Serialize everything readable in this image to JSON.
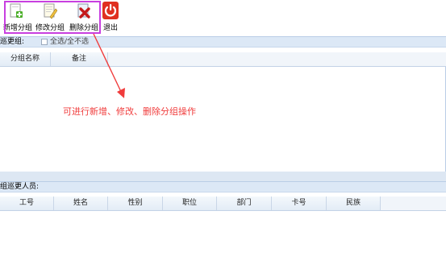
{
  "toolbar": {
    "buttons": [
      {
        "label": "新增分组",
        "icon": "add-group-icon"
      },
      {
        "label": "修改分组",
        "icon": "edit-group-icon"
      },
      {
        "label": "删除分组",
        "icon": "delete-group-icon"
      },
      {
        "label": "退出",
        "icon": "power-icon"
      }
    ]
  },
  "group_section": {
    "title": "巡更组:",
    "select_all_label": "全选/全不选",
    "columns": [
      "分组名称",
      "备注"
    ]
  },
  "annotation": "可进行新增、修改、删除分组操作",
  "member_section": {
    "title": "组巡更人员:",
    "columns": [
      "工号",
      "姓名",
      "性别",
      "职位",
      "部门",
      "卡号",
      "民族"
    ]
  },
  "colors": {
    "highlight": "#c83fe0",
    "annotation": "#f03c3c",
    "header_bg": "#dce8f6"
  }
}
